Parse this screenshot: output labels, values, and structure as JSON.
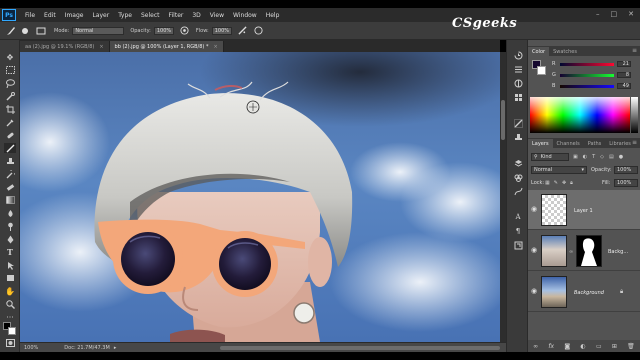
{
  "app": {
    "logo": "Ps"
  },
  "menu": [
    "File",
    "Edit",
    "Image",
    "Layer",
    "Type",
    "Select",
    "Filter",
    "3D",
    "View",
    "Window",
    "Help"
  ],
  "window_controls": {
    "minimize": "–",
    "restore": "□",
    "close": "✕"
  },
  "watermark": "CSgeeks",
  "options_bar": {
    "mode_label": "Mode:",
    "mode_value": "Normal",
    "opacity_label": "Opacity:",
    "opacity_value": "100%",
    "flow_label": "Flow:",
    "flow_value": "100%"
  },
  "tabs": [
    {
      "label": "aa (2).jpg @ 19.1% (RGB/8)",
      "close": "×",
      "active": false
    },
    {
      "label": "bb (2).jpg @ 100% (Layer 1, RGB/8) *",
      "close": "×",
      "active": true
    }
  ],
  "status": {
    "zoom": "100%",
    "doc": "Doc: 21.7M/47.3M"
  },
  "color_panel": {
    "tabs": [
      "Color",
      "Swatches"
    ],
    "r": "21",
    "g": "8",
    "b": "49"
  },
  "layers_panel": {
    "tabs": [
      "Layers",
      "Channels",
      "Paths",
      "Libraries"
    ],
    "kind": "Kind",
    "blend": "Normal",
    "opacity_label": "Opacity:",
    "opacity_value": "100%",
    "lock_label": "Lock:",
    "fill_label": "Fill:",
    "fill_value": "100%",
    "layers": [
      {
        "name": "Layer 1",
        "selected": true
      },
      {
        "name": "Backg...",
        "selected": false
      },
      {
        "name": "Background",
        "selected": false
      }
    ]
  },
  "colors": {
    "accent": "#31a8ff",
    "panel_bg": "#535353",
    "app_bg": "#3c3c3c"
  }
}
